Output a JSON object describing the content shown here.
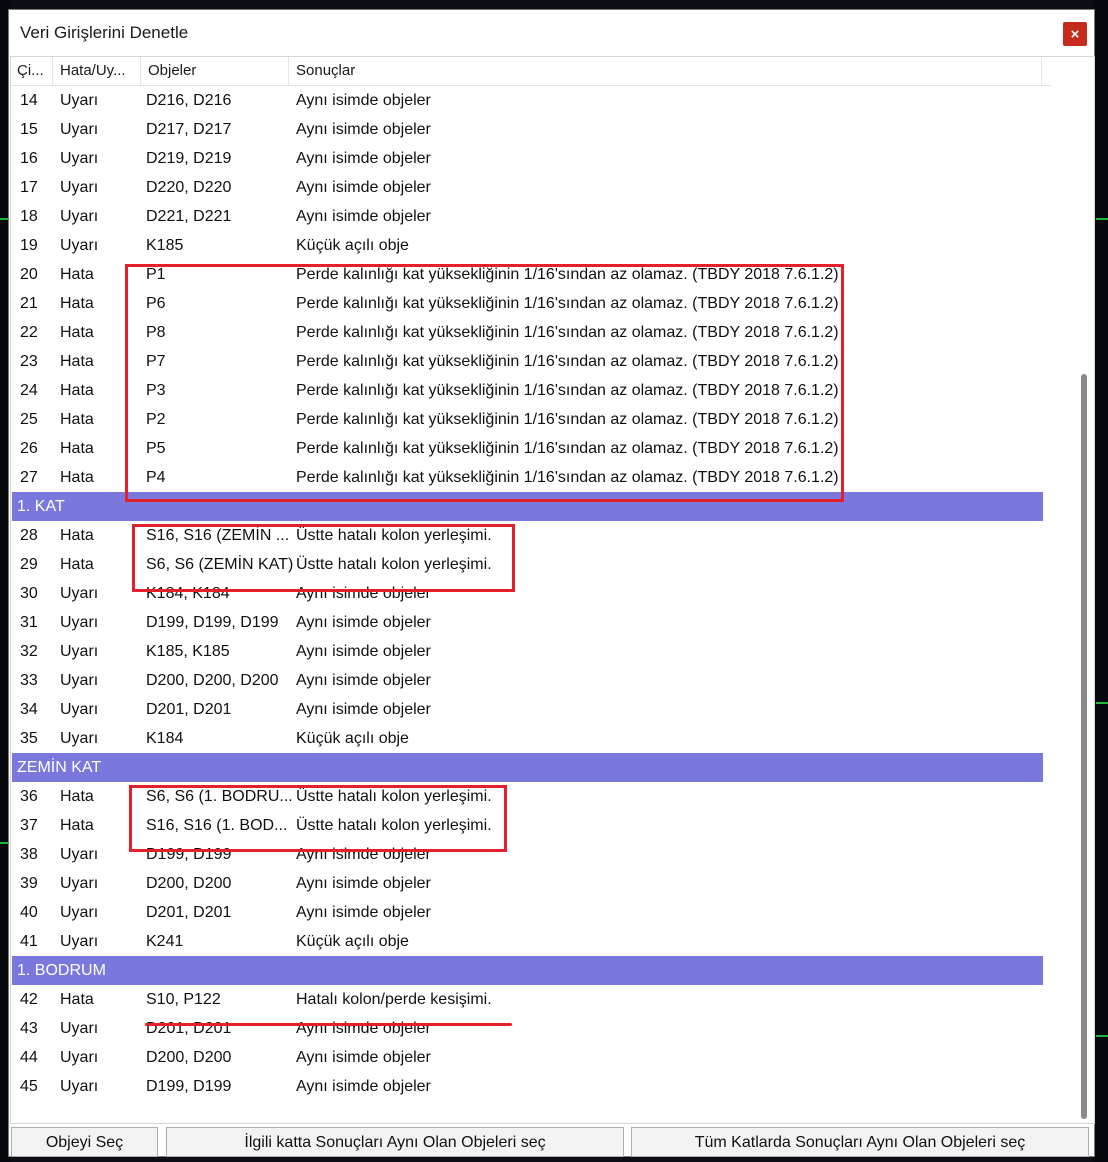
{
  "window": {
    "title": "Veri Girişlerini Denetle",
    "close_glyph": "×"
  },
  "columns": [
    "Çi...",
    "Hata/Uy...",
    "Objeler",
    "Sonuçlar"
  ],
  "colors": {
    "group_header": "#7a78dc",
    "highlight": "#e3202b",
    "close_button": "#c42b1c"
  },
  "sections": [
    {
      "group": null,
      "rows": [
        {
          "no": "14",
          "type": "Uyarı",
          "objects": "D216, D216",
          "result": "Aynı isimde objeler"
        },
        {
          "no": "15",
          "type": "Uyarı",
          "objects": "D217, D217",
          "result": "Aynı isimde objeler"
        },
        {
          "no": "16",
          "type": "Uyarı",
          "objects": "D219, D219",
          "result": "Aynı isimde objeler"
        },
        {
          "no": "17",
          "type": "Uyarı",
          "objects": "D220, D220",
          "result": "Aynı isimde objeler"
        },
        {
          "no": "18",
          "type": "Uyarı",
          "objects": "D221, D221",
          "result": "Aynı isimde objeler"
        },
        {
          "no": "19",
          "type": "Uyarı",
          "objects": "K185",
          "result": "Küçük açılı obje"
        },
        {
          "no": "20",
          "type": "Hata",
          "objects": "P1",
          "result": "Perde kalınlığı kat yüksekliğinin 1/16'sından az olamaz.  (TBDY 2018 7.6.1.2)"
        },
        {
          "no": "21",
          "type": "Hata",
          "objects": "P6",
          "result": "Perde kalınlığı kat yüksekliğinin 1/16'sından az olamaz.  (TBDY 2018 7.6.1.2)"
        },
        {
          "no": "22",
          "type": "Hata",
          "objects": "P8",
          "result": "Perde kalınlığı kat yüksekliğinin 1/16'sından az olamaz.  (TBDY 2018 7.6.1.2)"
        },
        {
          "no": "23",
          "type": "Hata",
          "objects": "P7",
          "result": "Perde kalınlığı kat yüksekliğinin 1/16'sından az olamaz.  (TBDY 2018 7.6.1.2)"
        },
        {
          "no": "24",
          "type": "Hata",
          "objects": "P3",
          "result": "Perde kalınlığı kat yüksekliğinin 1/16'sından az olamaz.  (TBDY 2018 7.6.1.2)"
        },
        {
          "no": "25",
          "type": "Hata",
          "objects": "P2",
          "result": "Perde kalınlığı kat yüksekliğinin 1/16'sından az olamaz.  (TBDY 2018 7.6.1.2)"
        },
        {
          "no": "26",
          "type": "Hata",
          "objects": "P5",
          "result": "Perde kalınlığı kat yüksekliğinin 1/16'sından az olamaz.  (TBDY 2018 7.6.1.2)"
        },
        {
          "no": "27",
          "type": "Hata",
          "objects": "P4",
          "result": "Perde kalınlığı kat yüksekliğinin 1/16'sından az olamaz.  (TBDY 2018 7.6.1.2)"
        }
      ]
    },
    {
      "group": "1. KAT",
      "rows": [
        {
          "no": "28",
          "type": "Hata",
          "objects": "S16, S16 (ZEMİN ...",
          "result": "Üstte hatalı kolon yerleşimi."
        },
        {
          "no": "29",
          "type": "Hata",
          "objects": "S6, S6 (ZEMİN KAT)",
          "result": "Üstte hatalı kolon yerleşimi."
        },
        {
          "no": "30",
          "type": "Uyarı",
          "objects": "K184, K184",
          "result": "Aynı isimde objeler"
        },
        {
          "no": "31",
          "type": "Uyarı",
          "objects": "D199, D199, D199",
          "result": "Aynı isimde objeler"
        },
        {
          "no": "32",
          "type": "Uyarı",
          "objects": "K185, K185",
          "result": "Aynı isimde objeler"
        },
        {
          "no": "33",
          "type": "Uyarı",
          "objects": "D200, D200, D200",
          "result": "Aynı isimde objeler"
        },
        {
          "no": "34",
          "type": "Uyarı",
          "objects": "D201, D201",
          "result": "Aynı isimde objeler"
        },
        {
          "no": "35",
          "type": "Uyarı",
          "objects": "K184",
          "result": "Küçük açılı obje"
        }
      ]
    },
    {
      "group": "ZEMİN KAT",
      "rows": [
        {
          "no": "36",
          "type": "Hata",
          "objects": "S6, S6 (1. BODRU...",
          "result": "Üstte hatalı kolon yerleşimi."
        },
        {
          "no": "37",
          "type": "Hata",
          "objects": "S16, S16 (1. BOD...",
          "result": "Üstte hatalı kolon yerleşimi."
        },
        {
          "no": "38",
          "type": "Uyarı",
          "objects": "D199, D199",
          "result": "Aynı isimde objeler"
        },
        {
          "no": "39",
          "type": "Uyarı",
          "objects": "D200, D200",
          "result": "Aynı isimde objeler"
        },
        {
          "no": "40",
          "type": "Uyarı",
          "objects": "D201, D201",
          "result": "Aynı isimde objeler"
        },
        {
          "no": "41",
          "type": "Uyarı",
          "objects": "K241",
          "result": "Küçük açılı obje"
        }
      ]
    },
    {
      "group": "1. BODRUM",
      "rows": [
        {
          "no": "42",
          "type": "Hata",
          "objects": "S10, P122",
          "result": "Hatalı kolon/perde kesişimi."
        },
        {
          "no": "43",
          "type": "Uyarı",
          "objects": "D201, D201",
          "result": "Aynı isimde objeler"
        },
        {
          "no": "44",
          "type": "Uyarı",
          "objects": "D200, D200",
          "result": "Aynı isimde objeler"
        },
        {
          "no": "45",
          "type": "Uyarı",
          "objects": "D199, D199",
          "result": "Aynı isimde objeler"
        }
      ]
    }
  ],
  "buttons": {
    "select_object": "Objeyi Seç",
    "select_same_floor": "İlgili katta Sonuçları Aynı Olan Objeleri seç",
    "select_all_floors": "Tüm Katlarda Sonuçları Aynı Olan Objeleri seç"
  }
}
